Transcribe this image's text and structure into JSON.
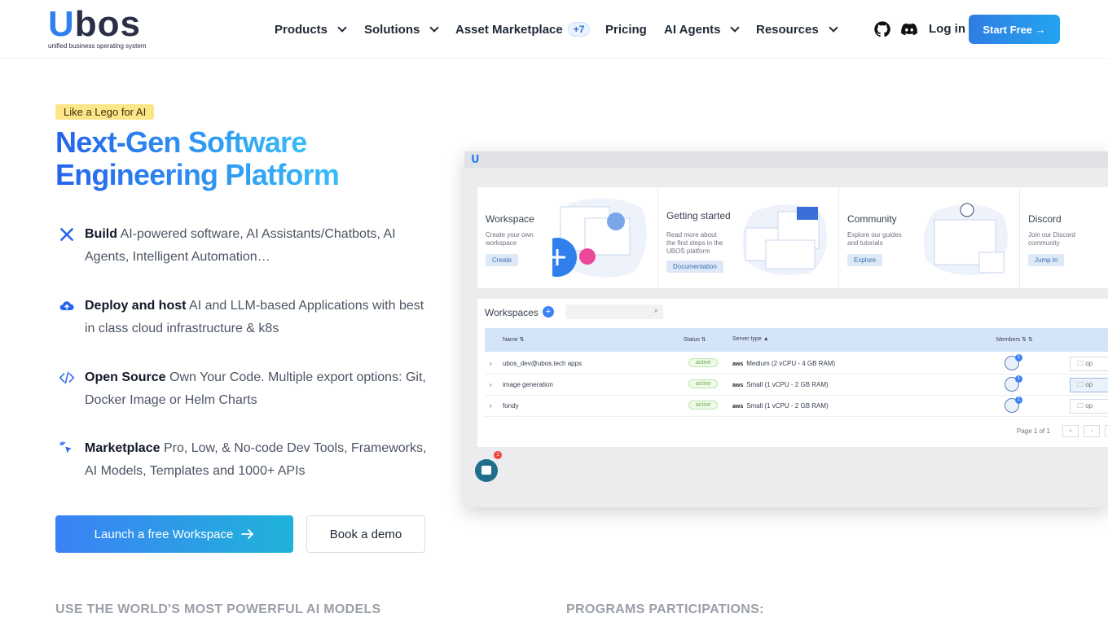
{
  "logo": {
    "wordmark_u": "U",
    "wordmark_rest": "bos",
    "tagline": "unified business operating system"
  },
  "nav": {
    "items": [
      {
        "label": "Products",
        "has_dropdown": true
      },
      {
        "label": "Solutions",
        "has_dropdown": true
      },
      {
        "label": "Asset Marketplace",
        "badge": "+7"
      },
      {
        "label": "Pricing"
      },
      {
        "label": "AI Agents",
        "has_dropdown": true
      },
      {
        "label": "Resources",
        "has_dropdown": true
      }
    ],
    "login": "Log in",
    "start_free": "Start Free →"
  },
  "hero": {
    "tag": "Like a Lego for AI",
    "title_line1": "Next-Gen Software",
    "title_line2": "Engineering Platform",
    "features": [
      {
        "icon": "tools-icon",
        "bold": "Build",
        "text": " AI-powered software, AI Assistants/Chatbots, AI Agents, Intelligent Automation…"
      },
      {
        "icon": "cloud-upload-icon",
        "bold": "Deploy and host",
        "text": " AI and LLM-based Applications with best in class cloud infrastructure & k8s"
      },
      {
        "icon": "code-icon",
        "bold": "Open Source",
        "text": " Own Your Code. Multiple export options: Git, Docker Image or Helm Charts"
      },
      {
        "icon": "sparkle-cursor-icon",
        "bold": "Marketplace",
        "text": " Pro, Low, & No-code Dev Tools, Frameworks, AI Models, Templates and 1000+ APIs"
      }
    ],
    "launch_button": "Launch a free Workspace",
    "demo_button": "Book a demo"
  },
  "preview": {
    "cards": [
      {
        "title": "Workspace",
        "desc": "Create your own workspace",
        "button": "Create"
      },
      {
        "title": "Getting started",
        "desc": "Read more about the first steps in the UBOS platform",
        "button": "Documentation"
      },
      {
        "title": "Community",
        "desc": "Explore our guides and tutorials",
        "button": "Explore"
      },
      {
        "title": "Discord",
        "desc": "Join our Discord community",
        "button": "Jump In"
      }
    ],
    "workspaces": {
      "title": "Workspaces",
      "columns": {
        "name": "Name",
        "status": "Status",
        "server": "Server type",
        "members": "Members"
      },
      "rows": [
        {
          "name": "ubos_dev@ubos.tech apps",
          "status": "active",
          "server": "Medium (2 vCPU - 4 GB RAM)",
          "members": "1"
        },
        {
          "name": "image generation",
          "status": "active",
          "server": "Small (1 vCPU - 2 GB RAM)",
          "members": "1"
        },
        {
          "name": "fondy",
          "status": "active",
          "server": "Small (1 vCPU - 2 GB RAM)",
          "members": "1"
        }
      ],
      "aws_label": "aws",
      "open_label": "op",
      "pager": "Page 1 of 1"
    },
    "chat_badge": "1"
  },
  "sections": {
    "left": "USE THE WORLD'S MOST POWERFUL AI MODELS",
    "right": "PROGRAMS PARTICIPATIONS:"
  }
}
